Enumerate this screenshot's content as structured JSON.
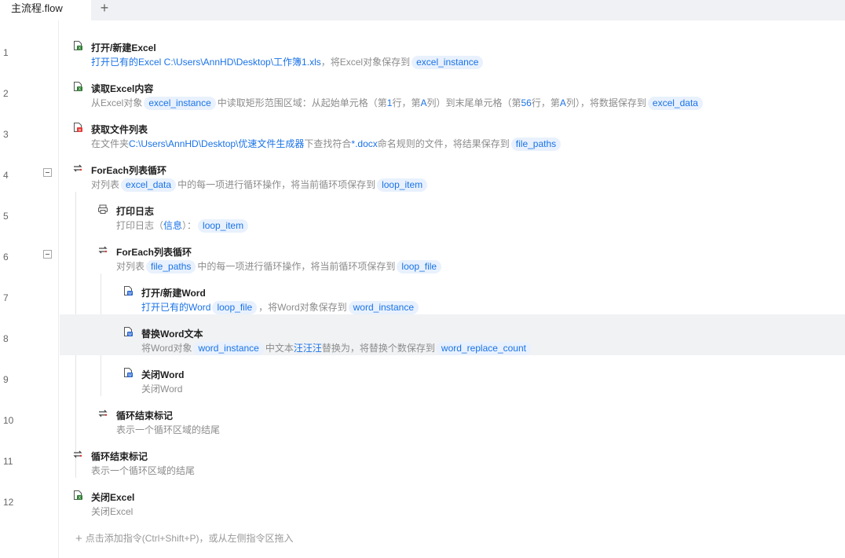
{
  "tab": {
    "title": "主流程.flow",
    "add": "+"
  },
  "line_numbers": [
    "1",
    "2",
    "3",
    "4",
    "5",
    "6",
    "7",
    "8",
    "9",
    "10",
    "11",
    "12"
  ],
  "steps": [
    {
      "title": "打开/新建Excel",
      "desc": [
        {
          "t": "打开已有的Excel C:\\Users\\AnnHD\\Desktop\\工作簿1.xls",
          "k": "link"
        },
        {
          "t": "，将Excel对象保存到",
          "k": "text"
        },
        {
          "t": "excel_instance",
          "k": "pill"
        }
      ]
    },
    {
      "title": "读取Excel内容",
      "desc": [
        {
          "t": "从Excel对象",
          "k": "text"
        },
        {
          "t": "excel_instance",
          "k": "pill"
        },
        {
          "t": "中读取矩形范围区域：从起始单元格（第",
          "k": "text"
        },
        {
          "t": "1",
          "k": "link"
        },
        {
          "t": "行，第",
          "k": "text"
        },
        {
          "t": "A",
          "k": "link"
        },
        {
          "t": "列）到末尾单元格（第",
          "k": "text"
        },
        {
          "t": "56",
          "k": "link"
        },
        {
          "t": "行，第",
          "k": "text"
        },
        {
          "t": "A",
          "k": "link"
        },
        {
          "t": "列），将数据保存到",
          "k": "text"
        },
        {
          "t": "excel_data",
          "k": "pill"
        }
      ]
    },
    {
      "title": "获取文件列表",
      "desc": [
        {
          "t": "在文件夹",
          "k": "text"
        },
        {
          "t": "C:\\Users\\AnnHD\\Desktop\\优速文件生成器",
          "k": "link"
        },
        {
          "t": "下查找符合",
          "k": "text"
        },
        {
          "t": "*.docx",
          "k": "link"
        },
        {
          "t": "命名规则的文件，将结果保存到",
          "k": "text"
        },
        {
          "t": "file_paths",
          "k": "pill"
        }
      ]
    },
    {
      "title": "ForEach列表循环",
      "desc": [
        {
          "t": "对列表",
          "k": "text"
        },
        {
          "t": "excel_data",
          "k": "pill"
        },
        {
          "t": "中的每一项进行循环操作，将当前循环项保存到",
          "k": "text"
        },
        {
          "t": "loop_item",
          "k": "pill"
        }
      ]
    },
    {
      "title": "打印日志",
      "desc": [
        {
          "t": "打印日志（",
          "k": "text"
        },
        {
          "t": "信息",
          "k": "link"
        },
        {
          "t": "）：",
          "k": "text"
        },
        {
          "t": "loop_item",
          "k": "pill"
        }
      ]
    },
    {
      "title": "ForEach列表循环",
      "desc": [
        {
          "t": "对列表",
          "k": "text"
        },
        {
          "t": "file_paths",
          "k": "pill"
        },
        {
          "t": "中的每一项进行循环操作，将当前循环项保存到",
          "k": "text"
        },
        {
          "t": "loop_file",
          "k": "pill"
        }
      ]
    },
    {
      "title": "打开/新建Word",
      "desc": [
        {
          "t": "打开已有的Word",
          "k": "link"
        },
        {
          "t": "loop_file",
          "k": "pill"
        },
        {
          "t": "，将Word对象保存到",
          "k": "text"
        },
        {
          "t": "word_instance",
          "k": "pill"
        }
      ]
    },
    {
      "title": "替换Word文本",
      "desc": [
        {
          "t": "将Word对象",
          "k": "text"
        },
        {
          "t": "word_instance",
          "k": "pill"
        },
        {
          "t": "中文本",
          "k": "text"
        },
        {
          "t": "汪汪汪",
          "k": "link"
        },
        {
          "t": "替换为，将替换个数保存到",
          "k": "text"
        },
        {
          "t": "word_replace_count",
          "k": "pill"
        }
      ]
    },
    {
      "title": "关闭Word",
      "desc": [
        {
          "t": "关闭Word",
          "k": "text"
        }
      ]
    },
    {
      "title": "循环结束标记",
      "desc": [
        {
          "t": "表示一个循环区域的结尾",
          "k": "text"
        }
      ]
    },
    {
      "title": "循环结束标记",
      "desc": [
        {
          "t": "表示一个循环区域的结尾",
          "k": "text"
        }
      ]
    },
    {
      "title": "关闭Excel",
      "desc": [
        {
          "t": "关闭Excel",
          "k": "text"
        }
      ]
    }
  ],
  "step_icons": [
    "excel-open-icon",
    "excel-read-icon",
    "file-list-icon",
    "loop-icon",
    "print-log-icon",
    "loop-icon",
    "word-open-icon",
    "word-replace-icon",
    "word-close-icon",
    "loop-end-icon",
    "loop-end-icon",
    "excel-close-icon"
  ],
  "add_hint": "点击添加指令(Ctrl+Shift+P)，或从左侧指令区拖入",
  "add_hint_plus": "+",
  "colors": {
    "link": "#1a73e8",
    "pill_bg": "#e8f1fd",
    "highlight_row": "#f1f2f4"
  }
}
